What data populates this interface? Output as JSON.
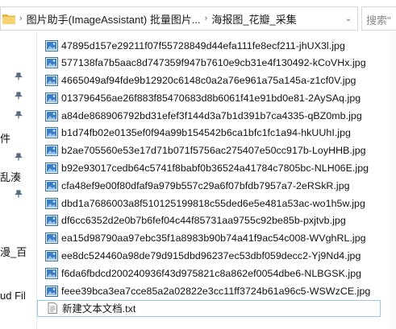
{
  "address_bar": {
    "crumbs": [
      "图片助手(ImageAssistant) 批量图片...",
      "海报图_花瓣_采集"
    ],
    "search_placeholder": "搜索\""
  },
  "nav": {
    "items": [
      {
        "label": "件"
      },
      {
        "label": "乱湊"
      },
      {
        "label": "漫_百"
      },
      {
        "label": "ud Fil"
      }
    ]
  },
  "files": [
    {
      "name": "47895d157e29211f07f55728849d44efa111fe8ecf211-jhUX3l.jpg",
      "type": "image"
    },
    {
      "name": "577138fa7b5aac8d747359f947b7610e9cb31e4f130492-kCoVHx.jpg",
      "type": "image"
    },
    {
      "name": "4665049af94fde9b12920c6148c0a2a76e961a75a145a-z1cf0V.jpg",
      "type": "image"
    },
    {
      "name": "013796456ae26f883f85470683d8b6061f41e91bd0e81-2AySAq.jpg",
      "type": "image"
    },
    {
      "name": "a84de868906792bd31efef3f144d3a7b1d391b7ca4335-qBZ0mb.jpg",
      "type": "image"
    },
    {
      "name": "b1d74fb02e0135ef0f94a99b154542b6ca1bfc1fc1a94-hkUUhI.jpg",
      "type": "image"
    },
    {
      "name": "b2ae705560e53e17d71b071f5756ac275407e50cc917b-LoyHHB.jpg",
      "type": "image"
    },
    {
      "name": "b92e93017cedb64c5741f8babf0b36524a41784c7805bc-NLH06E.jpg",
      "type": "image"
    },
    {
      "name": "cfa48ef9e00f80dfaf9a979b557c29a6f07bfdb7957a7-2eRSkR.jpg",
      "type": "image"
    },
    {
      "name": "dbd1a7686003a8f510125199818c55ded6e5e481a53ac-wo1h5w.jpg",
      "type": "image"
    },
    {
      "name": "df6cc6352d2e0b7b6fef04c44f85731aa9755c92be85b-pxjtvb.jpg",
      "type": "image"
    },
    {
      "name": "ea15d98790aa97ebc35f1a8983b90b74a41f9ac54c008-WVghRL.jpg",
      "type": "image"
    },
    {
      "name": "ee8dc524460a98de79d915dbd96237ec53dbf059decc2-Yj9Nd4.jpg",
      "type": "image"
    },
    {
      "name": "f6da6fbdcd200240936f43d975821c8a862ef0054dbe6-NLBGSK.jpg",
      "type": "image"
    },
    {
      "name": "feee39bca3ea7cce85a2a02822e3cc11ff3724b61a96c5-WSWzCE.jpg",
      "type": "image"
    },
    {
      "name": "新建文本文档.txt",
      "type": "text",
      "selected": true
    }
  ],
  "colors": {
    "selection_border": "#99c9ef",
    "folder_yellow": "#f3c94a",
    "image_icon_blue": "#3c7ec4"
  }
}
